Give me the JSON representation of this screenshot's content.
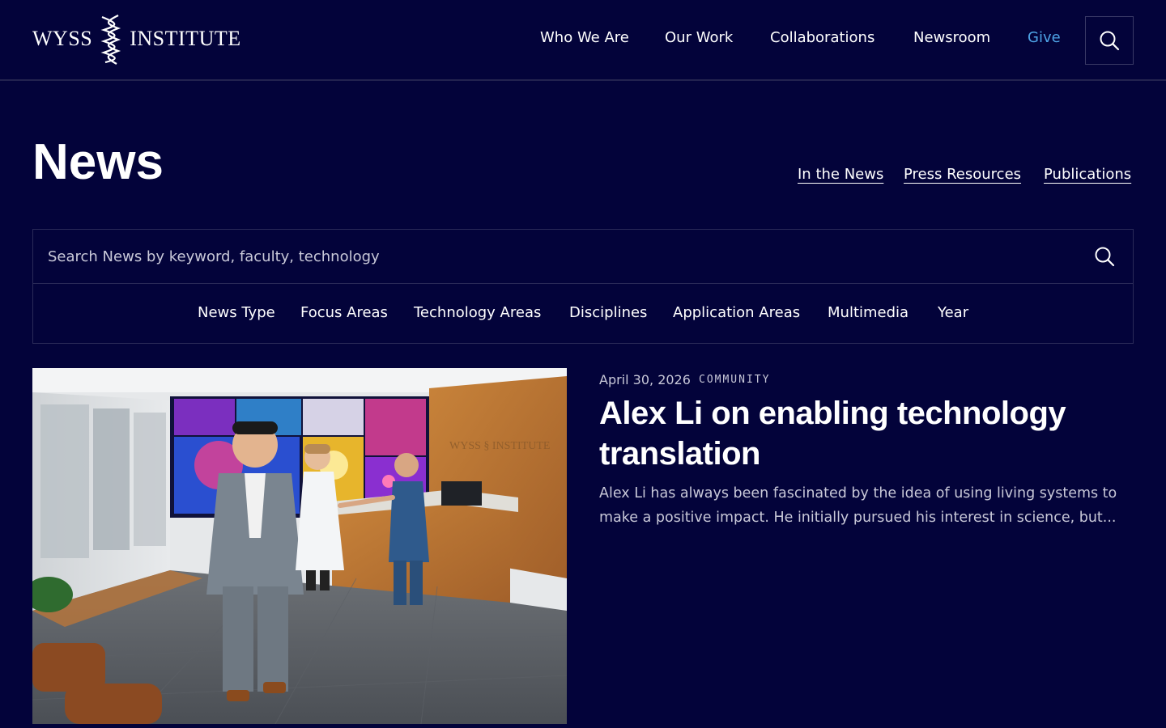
{
  "header": {
    "logo": {
      "left": "WYSS",
      "right": "INSTITUTE"
    },
    "nav": [
      {
        "label": "Who We Are"
      },
      {
        "label": "Our Work"
      },
      {
        "label": "Collaborations"
      },
      {
        "label": "Newsroom"
      },
      {
        "label": "Give"
      }
    ],
    "search_icon": "search-icon"
  },
  "page": {
    "title": "News",
    "links": [
      "In the News",
      "Press Resources",
      "Publications"
    ]
  },
  "search": {
    "placeholder": "Search News by keyword, faculty, technology",
    "value": ""
  },
  "filters": [
    "News Type",
    "Focus Areas",
    "Technology Areas",
    "Disciplines",
    "Application Areas",
    "Multimedia",
    "Year"
  ],
  "featured": {
    "date": "April 30, 2026",
    "category": "COMMUNITY",
    "title": "Alex Li on enabling technology translation",
    "excerpt": "Alex Li has always been fascinated by the idea of using living systems to make a positive impact. He initially pursued his interest in science, but..."
  },
  "colors": {
    "background": "#03033a",
    "accent": "#4ea3e6",
    "muted_text": "#c8c8d8"
  }
}
